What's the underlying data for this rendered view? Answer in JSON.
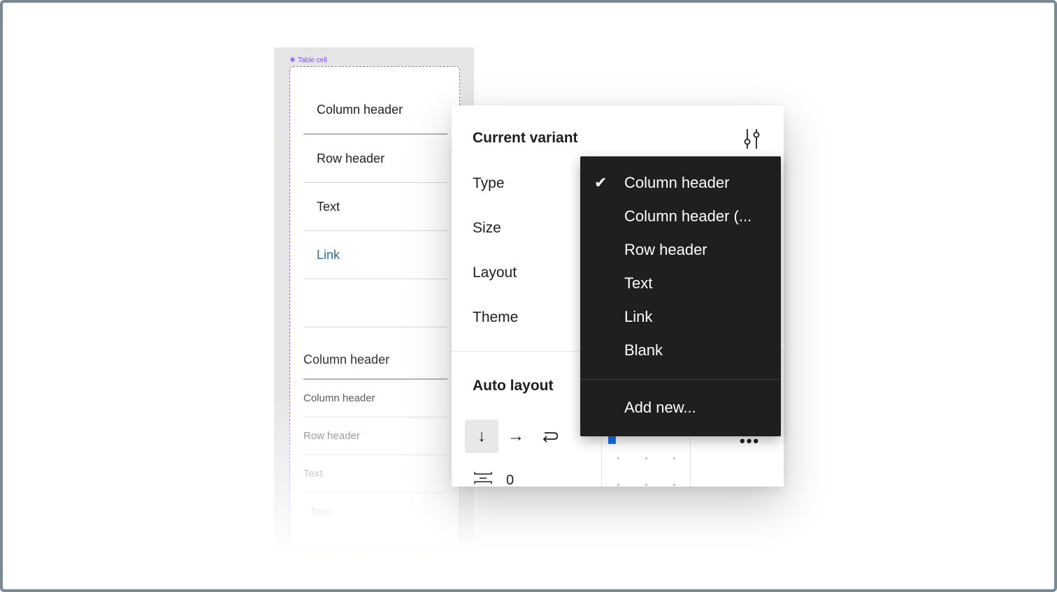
{
  "canvas": {
    "component_label": "Table cell",
    "cells": [
      {
        "label": "Column header"
      },
      {
        "label": "Row header"
      },
      {
        "label": "Text"
      },
      {
        "label": "Link"
      },
      {
        "label": ""
      }
    ],
    "preview_rows": [
      {
        "label": "Column header"
      },
      {
        "label": "Column header"
      },
      {
        "label": "Row header"
      },
      {
        "label": "Text"
      },
      {
        "label": "Text"
      }
    ]
  },
  "panel": {
    "title": "Current variant",
    "properties": [
      {
        "label": "Type"
      },
      {
        "label": "Size"
      },
      {
        "label": "Layout"
      },
      {
        "label": "Theme"
      }
    ],
    "auto_layout": {
      "title": "Auto layout",
      "direction_icons": [
        "arrow-down-icon",
        "arrow-right-icon",
        "wrap-icon"
      ],
      "spacing_value": "0"
    }
  },
  "dropdown": {
    "selected": "Column header",
    "options": [
      {
        "label": "Column header",
        "checked": true
      },
      {
        "label": "Column header (...",
        "checked": false
      },
      {
        "label": "Row header",
        "checked": false
      },
      {
        "label": "Text",
        "checked": false
      },
      {
        "label": "Link",
        "checked": false
      },
      {
        "label": "Blank",
        "checked": false
      }
    ],
    "add_new_label": "Add new..."
  },
  "colors": {
    "frame_border": "#7b8a92",
    "component_outline": "#8f6bff",
    "menu_background": "#1f1f1f",
    "link_text": "#2b6e9e",
    "selection_blue": "#1a73e8"
  }
}
